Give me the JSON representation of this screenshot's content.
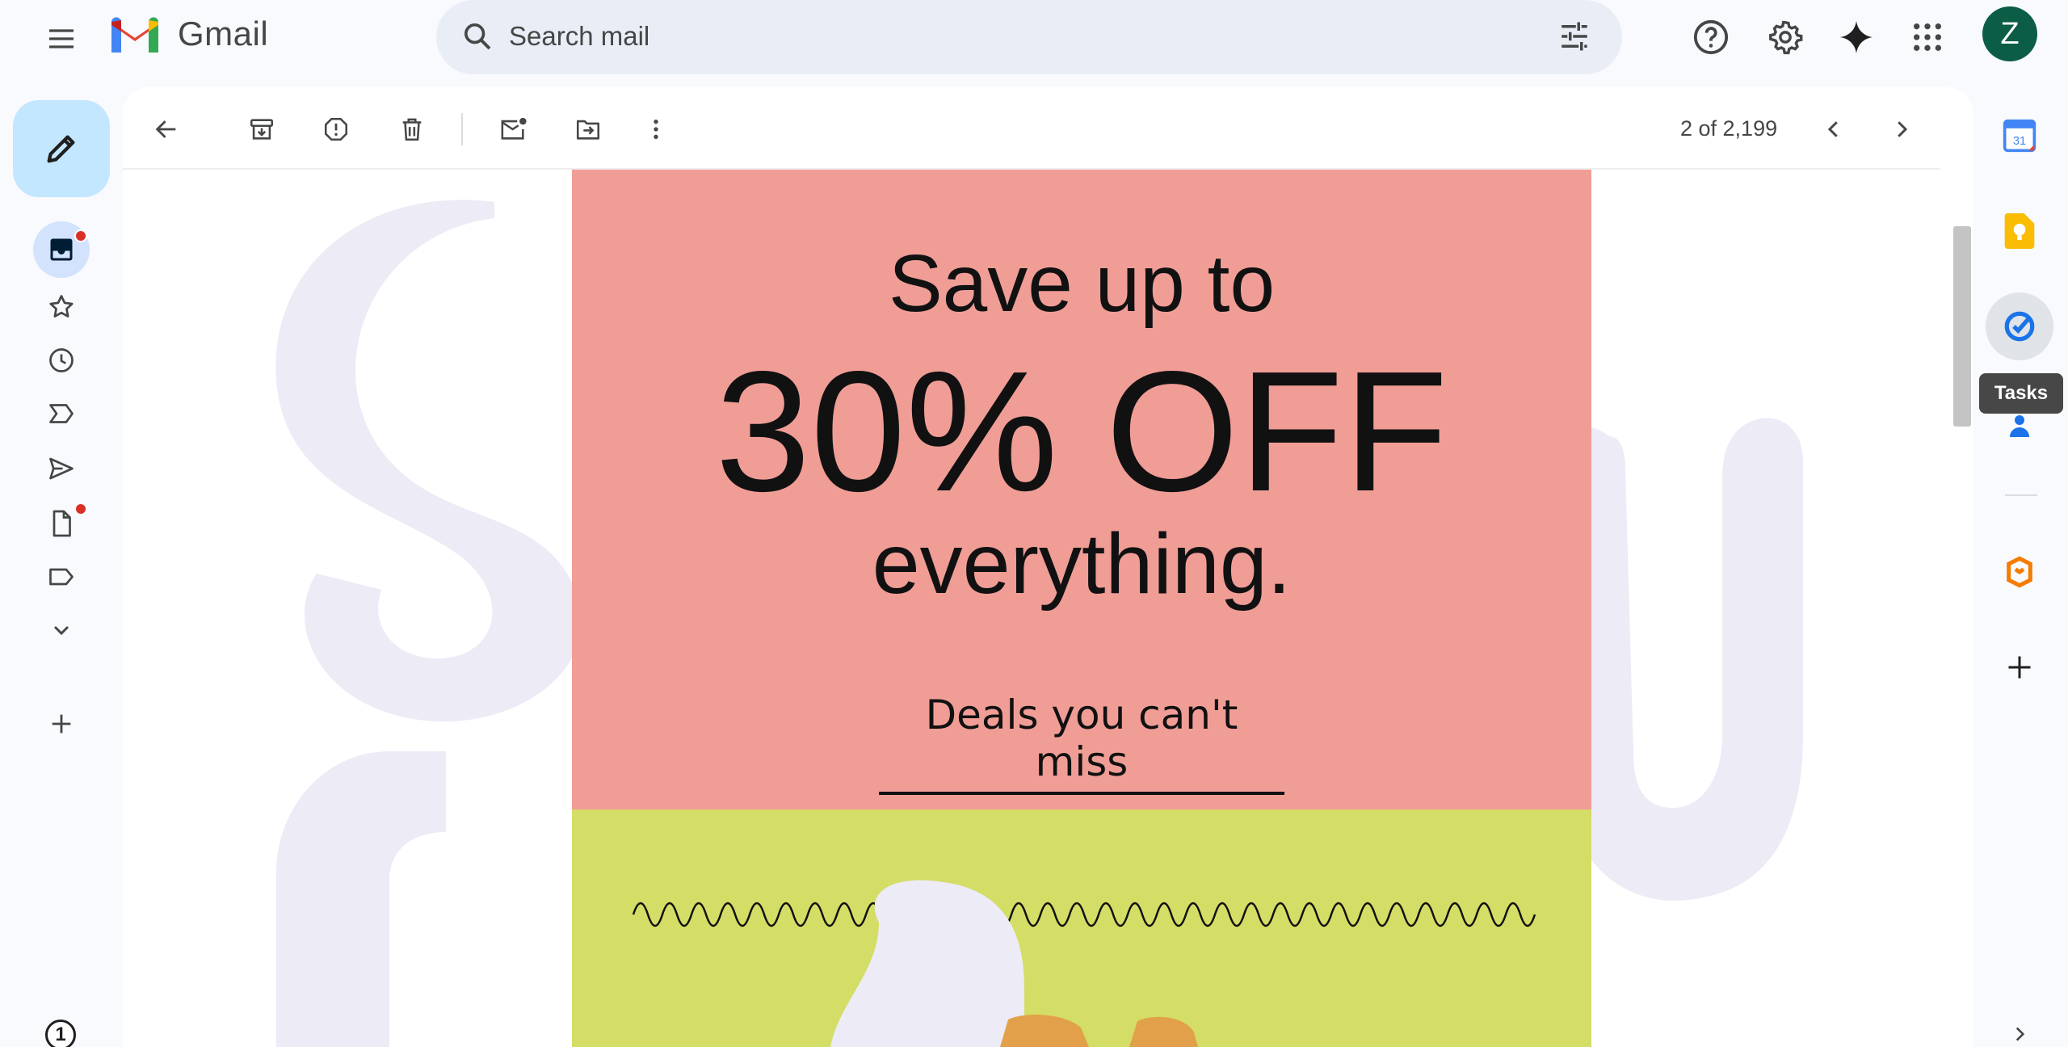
{
  "app": {
    "name": "Gmail"
  },
  "search": {
    "placeholder": "Search mail"
  },
  "account": {
    "avatar_letter": "Z",
    "avatar_color": "#0b5d46"
  },
  "nav": {
    "items": [
      {
        "name": "inbox",
        "icon": "inbox-icon",
        "unread_dot": true,
        "active": true
      },
      {
        "name": "starred",
        "icon": "star-icon"
      },
      {
        "name": "snoozed",
        "icon": "clock-icon"
      },
      {
        "name": "important",
        "icon": "label-important-icon"
      },
      {
        "name": "sent",
        "icon": "send-icon"
      },
      {
        "name": "drafts",
        "icon": "draft-icon",
        "unread_dot": true
      },
      {
        "name": "labels",
        "icon": "label-icon"
      },
      {
        "name": "more",
        "icon": "chevron-down-icon"
      },
      {
        "name": "create-label",
        "icon": "plus-icon"
      }
    ],
    "counter": "1"
  },
  "toolbar": {
    "pagination": "2 of 2,199"
  },
  "email": {
    "line1": "Save up to",
    "line2": "30% OFF",
    "line3": "everything.",
    "cta": "Deals you can't miss",
    "colors": {
      "top": "#f09d96",
      "bottom": "#d4dd66"
    }
  },
  "side_panel": {
    "apps": [
      "calendar-icon",
      "keep-icon",
      "tasks-icon",
      "contacts-icon",
      "addon-icon",
      "get-addons-icon"
    ],
    "tooltip": "Tasks",
    "calendar_day": "31"
  }
}
